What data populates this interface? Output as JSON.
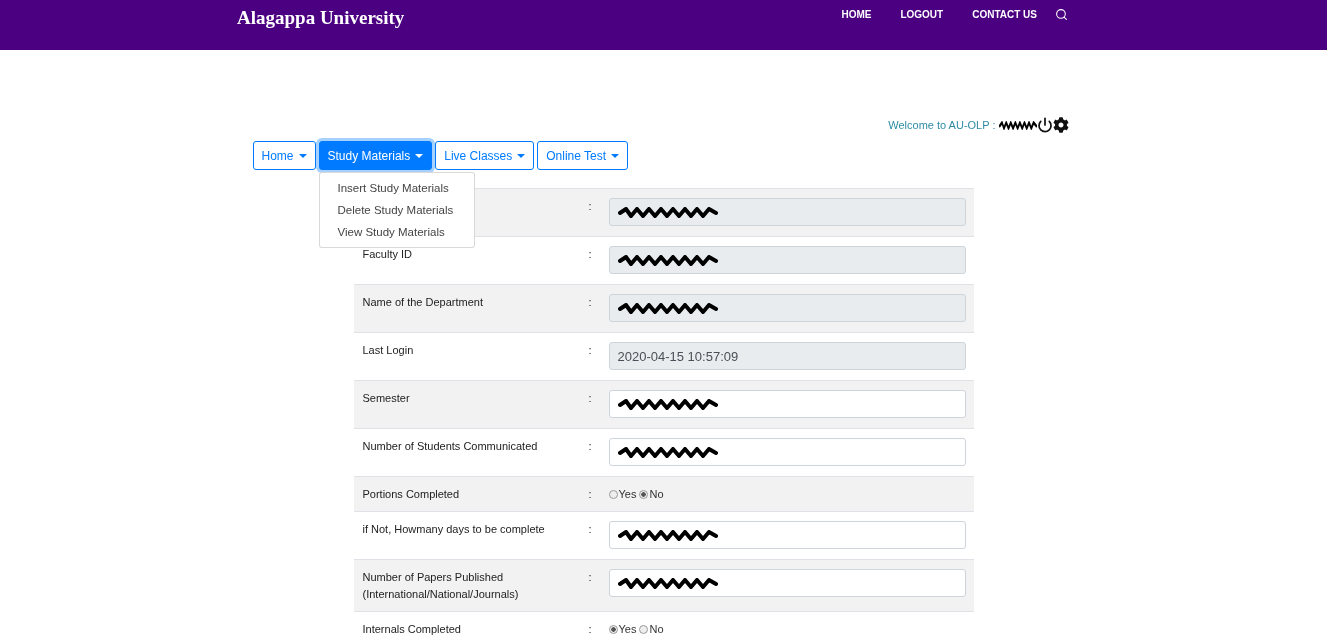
{
  "header": {
    "title": "Alagappa University",
    "nav": [
      "HOME",
      "LOGOUT",
      "CONTACT US"
    ]
  },
  "welcome": {
    "text": "Welcome to AU-OLP :",
    "user": {
      "redacted": true
    }
  },
  "menu": [
    {
      "label": "Home",
      "selected": false
    },
    {
      "label": "Study Materials",
      "selected": true,
      "expanded": true,
      "items": [
        "Insert Study Materials",
        "Delete Study Materials",
        "View Study Materials"
      ]
    },
    {
      "label": "Live Classes",
      "selected": false
    },
    {
      "label": "Online Test",
      "selected": false
    }
  ],
  "form": {
    "rows": [
      {
        "separator": ":",
        "kind": "readonly",
        "redacted": true
      },
      {
        "label": "Faculty ID",
        "separator": ":",
        "kind": "readonly",
        "redacted": true
      },
      {
        "label": "Name of the Department",
        "separator": ":",
        "kind": "readonly",
        "redacted": true
      },
      {
        "label": "Last Login",
        "separator": ":",
        "kind": "readonly",
        "value": "2020-04-15 10:57:09"
      },
      {
        "label": "Semester",
        "separator": ":",
        "kind": "text",
        "redacted": true
      },
      {
        "label": "Number of Students Communicated",
        "separator": ":",
        "kind": "text",
        "redacted": true
      },
      {
        "label": "Portions Completed",
        "separator": ":",
        "kind": "radio",
        "options": [
          {
            "label": "Yes",
            "selected": false
          },
          {
            "label": "No",
            "selected": true
          }
        ]
      },
      {
        "label": "if Not, Howmany days to be complete",
        "separator": ":",
        "kind": "text",
        "redacted": true
      },
      {
        "label": "Number of Papers Published (International/National/Journals)",
        "separator": ":",
        "kind": "text",
        "redacted": true
      },
      {
        "label": "Internals Completed",
        "separator": ":",
        "kind": "radio",
        "options": [
          {
            "label": "Yes",
            "selected": true
          },
          {
            "label": "No",
            "selected": false
          }
        ]
      }
    ]
  }
}
